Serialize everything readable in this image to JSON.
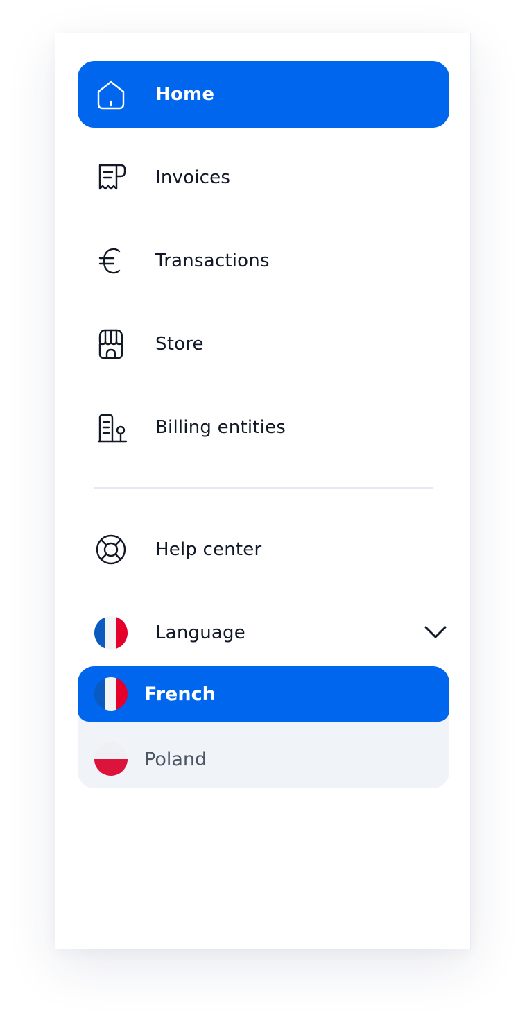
{
  "nav": {
    "items": [
      {
        "label": "Home",
        "icon": "home-icon",
        "active": true
      },
      {
        "label": "Invoices",
        "icon": "receipt-icon"
      },
      {
        "label": "Transactions",
        "icon": "euro-icon"
      },
      {
        "label": "Store",
        "icon": "store-icon"
      },
      {
        "label": "Billing entities",
        "icon": "building-icon"
      }
    ]
  },
  "secondary": {
    "help_label": "Help center",
    "help_icon": "lifebuoy-icon",
    "language_label": "Language",
    "language_icon": "france-flag-icon",
    "chevron_icon": "chevron-down-icon"
  },
  "language_menu": {
    "options": [
      {
        "label": "French",
        "flag": "france-flag-icon",
        "selected": true
      },
      {
        "label": "Poland",
        "flag": "poland-flag-icon"
      }
    ]
  },
  "colors": {
    "accent": "#0066ee",
    "text": "#111827",
    "muted_text": "#4b5563",
    "menu_bg": "#f0f3f8",
    "divider": "#e5e8f0",
    "flag_fr_blue": "#0a5ac0",
    "flag_fr_white": "#f3f4f6",
    "flag_fr_red": "#e4002b",
    "flag_pl_white": "#eef0f4",
    "flag_pl_red": "#dc143c"
  }
}
